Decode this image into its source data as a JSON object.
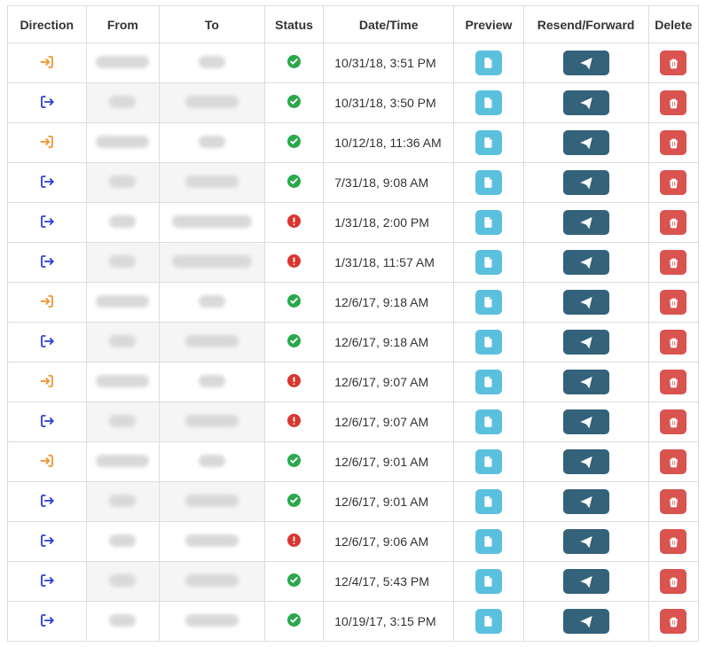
{
  "columns": {
    "direction": "Direction",
    "from": "From",
    "to": "To",
    "status": "Status",
    "datetime": "Date/Time",
    "preview": "Preview",
    "resend": "Resend/Forward",
    "delete": "Delete"
  },
  "icons": {
    "direction_in": "sign-in-icon",
    "direction_out": "sign-out-icon",
    "status_ok": "check-circle-icon",
    "status_error": "exclamation-circle-icon",
    "preview": "file-icon",
    "resend": "paper-plane-icon",
    "delete": "trash-icon"
  },
  "colors": {
    "direction_in": "#f0932b",
    "direction_out": "#2a3fd6",
    "status_ok": "#2aa84a",
    "status_error": "#d9362f",
    "preview_btn": "#5bc0de",
    "resend_btn": "#34627a",
    "delete_btn": "#d9534f"
  },
  "rows": [
    {
      "direction": "in",
      "from_w": "w2",
      "to_w": "w1",
      "status": "ok",
      "datetime": "10/31/18, 3:51 PM"
    },
    {
      "direction": "out",
      "from_w": "w1",
      "to_w": "w2",
      "status": "ok",
      "datetime": "10/31/18, 3:50 PM"
    },
    {
      "direction": "in",
      "from_w": "w2",
      "to_w": "w1",
      "status": "ok",
      "datetime": "10/12/18, 11:36 AM"
    },
    {
      "direction": "out",
      "from_w": "w1",
      "to_w": "w2",
      "status": "ok",
      "datetime": "7/31/18, 9:08 AM"
    },
    {
      "direction": "out",
      "from_w": "w1",
      "to_w": "w3",
      "status": "error",
      "datetime": "1/31/18, 2:00 PM"
    },
    {
      "direction": "out",
      "from_w": "w1",
      "to_w": "w3",
      "status": "error",
      "datetime": "1/31/18, 11:57 AM"
    },
    {
      "direction": "in",
      "from_w": "w2",
      "to_w": "w1",
      "status": "ok",
      "datetime": "12/6/17, 9:18 AM"
    },
    {
      "direction": "out",
      "from_w": "w1",
      "to_w": "w2",
      "status": "ok",
      "datetime": "12/6/17, 9:18 AM"
    },
    {
      "direction": "in",
      "from_w": "w2",
      "to_w": "w1",
      "status": "error",
      "datetime": "12/6/17, 9:07 AM"
    },
    {
      "direction": "out",
      "from_w": "w1",
      "to_w": "w2",
      "status": "error",
      "datetime": "12/6/17, 9:07 AM"
    },
    {
      "direction": "in",
      "from_w": "w2",
      "to_w": "w1",
      "status": "ok",
      "datetime": "12/6/17, 9:01 AM"
    },
    {
      "direction": "out",
      "from_w": "w1",
      "to_w": "w2",
      "status": "ok",
      "datetime": "12/6/17, 9:01 AM"
    },
    {
      "direction": "out",
      "from_w": "w1",
      "to_w": "w2",
      "status": "error",
      "datetime": "12/6/17, 9:06 AM"
    },
    {
      "direction": "out",
      "from_w": "w1",
      "to_w": "w2",
      "status": "ok",
      "datetime": "12/4/17, 5:43 PM"
    },
    {
      "direction": "out",
      "from_w": "w1",
      "to_w": "w2",
      "status": "ok",
      "datetime": "10/19/17, 3:15 PM"
    }
  ]
}
